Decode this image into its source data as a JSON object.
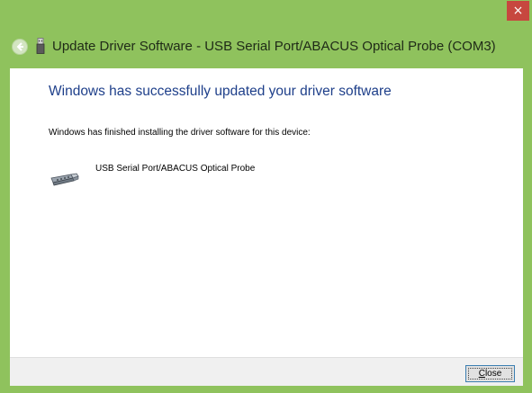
{
  "window": {
    "close_glyph": "×",
    "title": "Update Driver Software - USB Serial Port/ABACUS Optical Probe (COM3)"
  },
  "content": {
    "heading": "Windows has successfully updated your driver software",
    "message": "Windows has finished installing the driver software for this device:",
    "device_name": "USB Serial Port/ABACUS Optical Probe"
  },
  "footer": {
    "close_mnemonic": "C",
    "close_rest": "lose"
  },
  "colors": {
    "frame": "#8fc25d",
    "close_button_bg": "#c7473f",
    "heading": "#1e3f8a"
  },
  "icons": {
    "back": "back-arrow-icon",
    "usb": "usb-device-icon",
    "device": "serial-port-icon"
  }
}
